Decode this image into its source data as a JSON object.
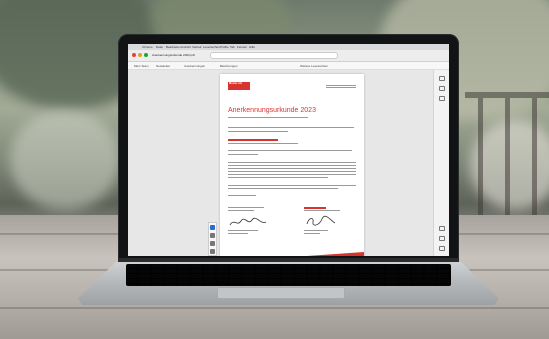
{
  "browser": {
    "menu_items": [
      "Chrome",
      "Datei",
      "Bearbeiten",
      "Ansicht",
      "Verlauf",
      "Lesezeichen",
      "Profile",
      "Tab",
      "Fenster",
      "Hilfe"
    ],
    "tab_title": "Anerkennungsurkunde 2023.pdf",
    "bookmarks": [
      "Mein Team",
      "Newsletter",
      "Anerkennungen",
      "Belohnungen",
      "Weitere Lesezeichen"
    ]
  },
  "document": {
    "logo_text": "Muster AG",
    "title": "Anerkennungsurkunde 2023",
    "accent_color": "#d8342f"
  }
}
